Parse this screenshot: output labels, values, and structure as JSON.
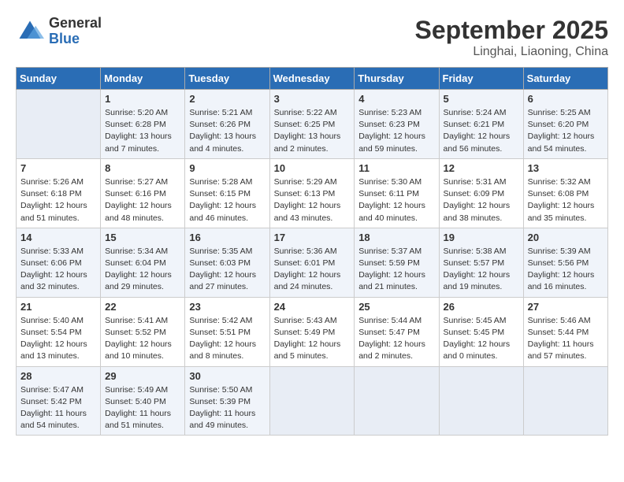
{
  "header": {
    "logo_general": "General",
    "logo_blue": "Blue",
    "month_year": "September 2025",
    "location": "Linghai, Liaoning, China"
  },
  "weekdays": [
    "Sunday",
    "Monday",
    "Tuesday",
    "Wednesday",
    "Thursday",
    "Friday",
    "Saturday"
  ],
  "weeks": [
    [
      {
        "day": "",
        "empty": true
      },
      {
        "day": "1",
        "sunrise": "5:20 AM",
        "sunset": "6:28 PM",
        "daylight": "13 hours and 7 minutes."
      },
      {
        "day": "2",
        "sunrise": "5:21 AM",
        "sunset": "6:26 PM",
        "daylight": "13 hours and 4 minutes."
      },
      {
        "day": "3",
        "sunrise": "5:22 AM",
        "sunset": "6:25 PM",
        "daylight": "13 hours and 2 minutes."
      },
      {
        "day": "4",
        "sunrise": "5:23 AM",
        "sunset": "6:23 PM",
        "daylight": "12 hours and 59 minutes."
      },
      {
        "day": "5",
        "sunrise": "5:24 AM",
        "sunset": "6:21 PM",
        "daylight": "12 hours and 56 minutes."
      },
      {
        "day": "6",
        "sunrise": "5:25 AM",
        "sunset": "6:20 PM",
        "daylight": "12 hours and 54 minutes."
      }
    ],
    [
      {
        "day": "7",
        "sunrise": "5:26 AM",
        "sunset": "6:18 PM",
        "daylight": "12 hours and 51 minutes."
      },
      {
        "day": "8",
        "sunrise": "5:27 AM",
        "sunset": "6:16 PM",
        "daylight": "12 hours and 48 minutes."
      },
      {
        "day": "9",
        "sunrise": "5:28 AM",
        "sunset": "6:15 PM",
        "daylight": "12 hours and 46 minutes."
      },
      {
        "day": "10",
        "sunrise": "5:29 AM",
        "sunset": "6:13 PM",
        "daylight": "12 hours and 43 minutes."
      },
      {
        "day": "11",
        "sunrise": "5:30 AM",
        "sunset": "6:11 PM",
        "daylight": "12 hours and 40 minutes."
      },
      {
        "day": "12",
        "sunrise": "5:31 AM",
        "sunset": "6:09 PM",
        "daylight": "12 hours and 38 minutes."
      },
      {
        "day": "13",
        "sunrise": "5:32 AM",
        "sunset": "6:08 PM",
        "daylight": "12 hours and 35 minutes."
      }
    ],
    [
      {
        "day": "14",
        "sunrise": "5:33 AM",
        "sunset": "6:06 PM",
        "daylight": "12 hours and 32 minutes."
      },
      {
        "day": "15",
        "sunrise": "5:34 AM",
        "sunset": "6:04 PM",
        "daylight": "12 hours and 29 minutes."
      },
      {
        "day": "16",
        "sunrise": "5:35 AM",
        "sunset": "6:03 PM",
        "daylight": "12 hours and 27 minutes."
      },
      {
        "day": "17",
        "sunrise": "5:36 AM",
        "sunset": "6:01 PM",
        "daylight": "12 hours and 24 minutes."
      },
      {
        "day": "18",
        "sunrise": "5:37 AM",
        "sunset": "5:59 PM",
        "daylight": "12 hours and 21 minutes."
      },
      {
        "day": "19",
        "sunrise": "5:38 AM",
        "sunset": "5:57 PM",
        "daylight": "12 hours and 19 minutes."
      },
      {
        "day": "20",
        "sunrise": "5:39 AM",
        "sunset": "5:56 PM",
        "daylight": "12 hours and 16 minutes."
      }
    ],
    [
      {
        "day": "21",
        "sunrise": "5:40 AM",
        "sunset": "5:54 PM",
        "daylight": "12 hours and 13 minutes."
      },
      {
        "day": "22",
        "sunrise": "5:41 AM",
        "sunset": "5:52 PM",
        "daylight": "12 hours and 10 minutes."
      },
      {
        "day": "23",
        "sunrise": "5:42 AM",
        "sunset": "5:51 PM",
        "daylight": "12 hours and 8 minutes."
      },
      {
        "day": "24",
        "sunrise": "5:43 AM",
        "sunset": "5:49 PM",
        "daylight": "12 hours and 5 minutes."
      },
      {
        "day": "25",
        "sunrise": "5:44 AM",
        "sunset": "5:47 PM",
        "daylight": "12 hours and 2 minutes."
      },
      {
        "day": "26",
        "sunrise": "5:45 AM",
        "sunset": "5:45 PM",
        "daylight": "12 hours and 0 minutes."
      },
      {
        "day": "27",
        "sunrise": "5:46 AM",
        "sunset": "5:44 PM",
        "daylight": "11 hours and 57 minutes."
      }
    ],
    [
      {
        "day": "28",
        "sunrise": "5:47 AM",
        "sunset": "5:42 PM",
        "daylight": "11 hours and 54 minutes."
      },
      {
        "day": "29",
        "sunrise": "5:49 AM",
        "sunset": "5:40 PM",
        "daylight": "11 hours and 51 minutes."
      },
      {
        "day": "30",
        "sunrise": "5:50 AM",
        "sunset": "5:39 PM",
        "daylight": "11 hours and 49 minutes."
      },
      {
        "day": "",
        "empty": true
      },
      {
        "day": "",
        "empty": true
      },
      {
        "day": "",
        "empty": true
      },
      {
        "day": "",
        "empty": true
      }
    ]
  ]
}
